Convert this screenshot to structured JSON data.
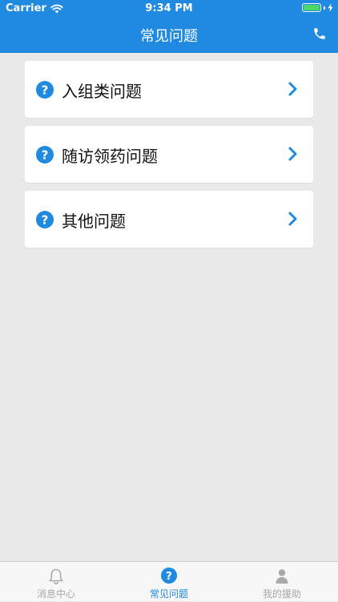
{
  "status_bar": {
    "carrier": "Carrier",
    "time": "9:34 PM",
    "battery_level": 1.0
  },
  "nav": {
    "title": "常见问题"
  },
  "items": [
    {
      "label": "入组类问题"
    },
    {
      "label": "随访领药问题"
    },
    {
      "label": "其他问题"
    }
  ],
  "tabs": [
    {
      "label": "消息中心",
      "icon": "bell-icon",
      "active": false
    },
    {
      "label": "常见问题",
      "icon": "question-circle-icon",
      "active": true
    },
    {
      "label": "我的援助",
      "icon": "user-icon",
      "active": false
    }
  ],
  "colors": {
    "primary": "#1f8ae0",
    "tab_active": "#1f8ae0",
    "tab_inactive": "#a8a8a8",
    "background": "#e9e9e9",
    "battery": "#4cd964"
  }
}
